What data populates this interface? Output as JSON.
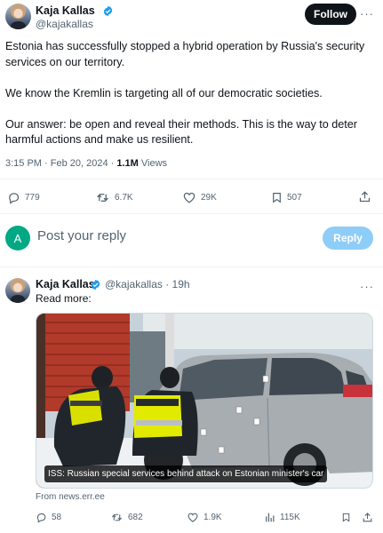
{
  "main_tweet": {
    "author_name": "Kaja Kallas",
    "handle": "@kajakallas",
    "follow_label": "Follow",
    "more_label": "···",
    "paragraphs": [
      "Estonia has successfully stopped a hybrid operation by Russia's security services on our territory.",
      "We know the Kremlin is targeting all of our democratic societies.",
      "Our answer: be open and reveal their methods. This is the way to deter harmful actions and make us resilient."
    ],
    "timestamp": "3:15 PM · Feb 20, 2024 · ",
    "views_count": "1.1M",
    "views_label": " Views",
    "actions": {
      "replies": "779",
      "reposts": "6.7K",
      "likes": "29K",
      "bookmarks": "507"
    }
  },
  "reply_composer": {
    "avatar_letter": "A",
    "placeholder": "Post your reply",
    "reply_label": "Reply"
  },
  "reply_tweet": {
    "author_name": "Kaja Kallas",
    "handle_time": "@kajakallas · 19h",
    "more_label": "···",
    "text": "Read more:",
    "card_caption": "ISS: Russian special services behind attack on Estonian minister's car",
    "card_source": "From news.err.ee",
    "actions": {
      "replies": "58",
      "reposts": "682",
      "likes": "1.9K",
      "views": "115K"
    }
  },
  "colors": {
    "verified_blue": "#1d9bf0",
    "reply_button_disabled": "#8ecdf7",
    "avatar_letter_bg": "#00a884",
    "police_vest": "#e8f000"
  },
  "icons": [
    "verified-badge-icon",
    "reply-icon",
    "repost-icon",
    "like-icon",
    "bookmark-icon",
    "share-icon",
    "views-icon",
    "more-icon"
  ]
}
